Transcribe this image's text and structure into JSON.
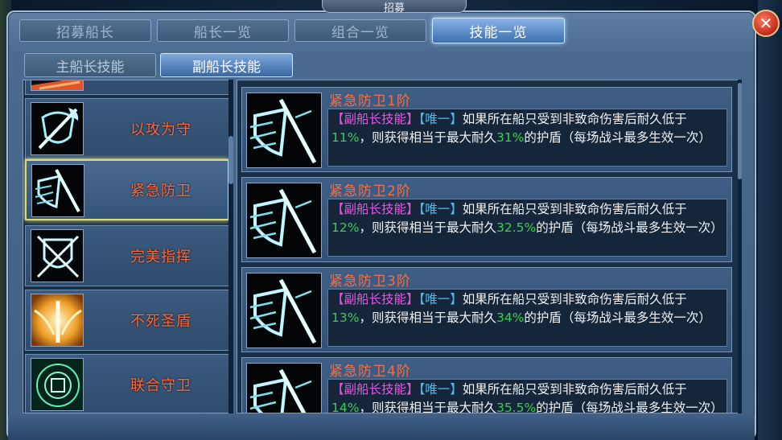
{
  "window": {
    "title": "招募"
  },
  "tabs": [
    {
      "label": "招募船长",
      "active": false
    },
    {
      "label": "船长一览",
      "active": false
    },
    {
      "label": "组合一览",
      "active": false
    },
    {
      "label": "技能一览",
      "active": true
    }
  ],
  "subtabs": [
    {
      "label": "主船长技能",
      "active": false
    },
    {
      "label": "副船长技能",
      "active": true
    }
  ],
  "skills": [
    {
      "name": "",
      "icon": "fire-skill-icon",
      "partial": true
    },
    {
      "name": "以攻为守",
      "icon": "shield-axe-icon",
      "selected": false
    },
    {
      "name": "紧急防卫",
      "icon": "emergency-shield-icon",
      "selected": true
    },
    {
      "name": "完美指挥",
      "icon": "crossed-swords-shield-icon",
      "selected": false
    },
    {
      "name": "不死圣盾",
      "icon": "golden-winged-shield-icon",
      "selected": false
    },
    {
      "name": "联合守卫",
      "icon": "green-rune-circle-icon",
      "selected": false
    }
  ],
  "levels": [
    {
      "title": "紧急防卫1阶",
      "tag_skill": "【副船长技能】",
      "tag_unique": "【唯一】",
      "desc_a": "如果所在船只受到非致命伤害后耐久低于",
      "pct1": "11%",
      "desc_b": "，则获得相当于最大耐久",
      "pct2": "31%",
      "desc_c": "的护盾（每场战斗最多生效一次）"
    },
    {
      "title": "紧急防卫2阶",
      "tag_skill": "【副船长技能】",
      "tag_unique": "【唯一】",
      "desc_a": "如果所在船只受到非致命伤害后耐久低于",
      "pct1": "12%",
      "desc_b": "，则获得相当于最大耐久",
      "pct2": "32.5%",
      "desc_c": "的护盾（每场战斗最多生效一次）"
    },
    {
      "title": "紧急防卫3阶",
      "tag_skill": "【副船长技能】",
      "tag_unique": "【唯一】",
      "desc_a": "如果所在船只受到非致命伤害后耐久低于",
      "pct1": "13%",
      "desc_b": "，则获得相当于最大耐久",
      "pct2": "34%",
      "desc_c": "的护盾（每场战斗最多生效一次）"
    },
    {
      "title": "紧急防卫4阶",
      "tag_skill": "【副船长技能】",
      "tag_unique": "【唯一】",
      "desc_a": "如果所在船只受到非致命伤害后耐久低于",
      "pct1": "14%",
      "desc_b": "，则获得相当于最大耐久",
      "pct2": "35.5%",
      "desc_c": "的护盾（每场战斗最多生效一次）"
    }
  ],
  "colors": {
    "skill_name": "#ff6a3a",
    "tag_skill": "#e05ae0",
    "tag_unique": "#4fbdf2",
    "percent": "#35d24a",
    "selected_border": "#d9d87a"
  }
}
